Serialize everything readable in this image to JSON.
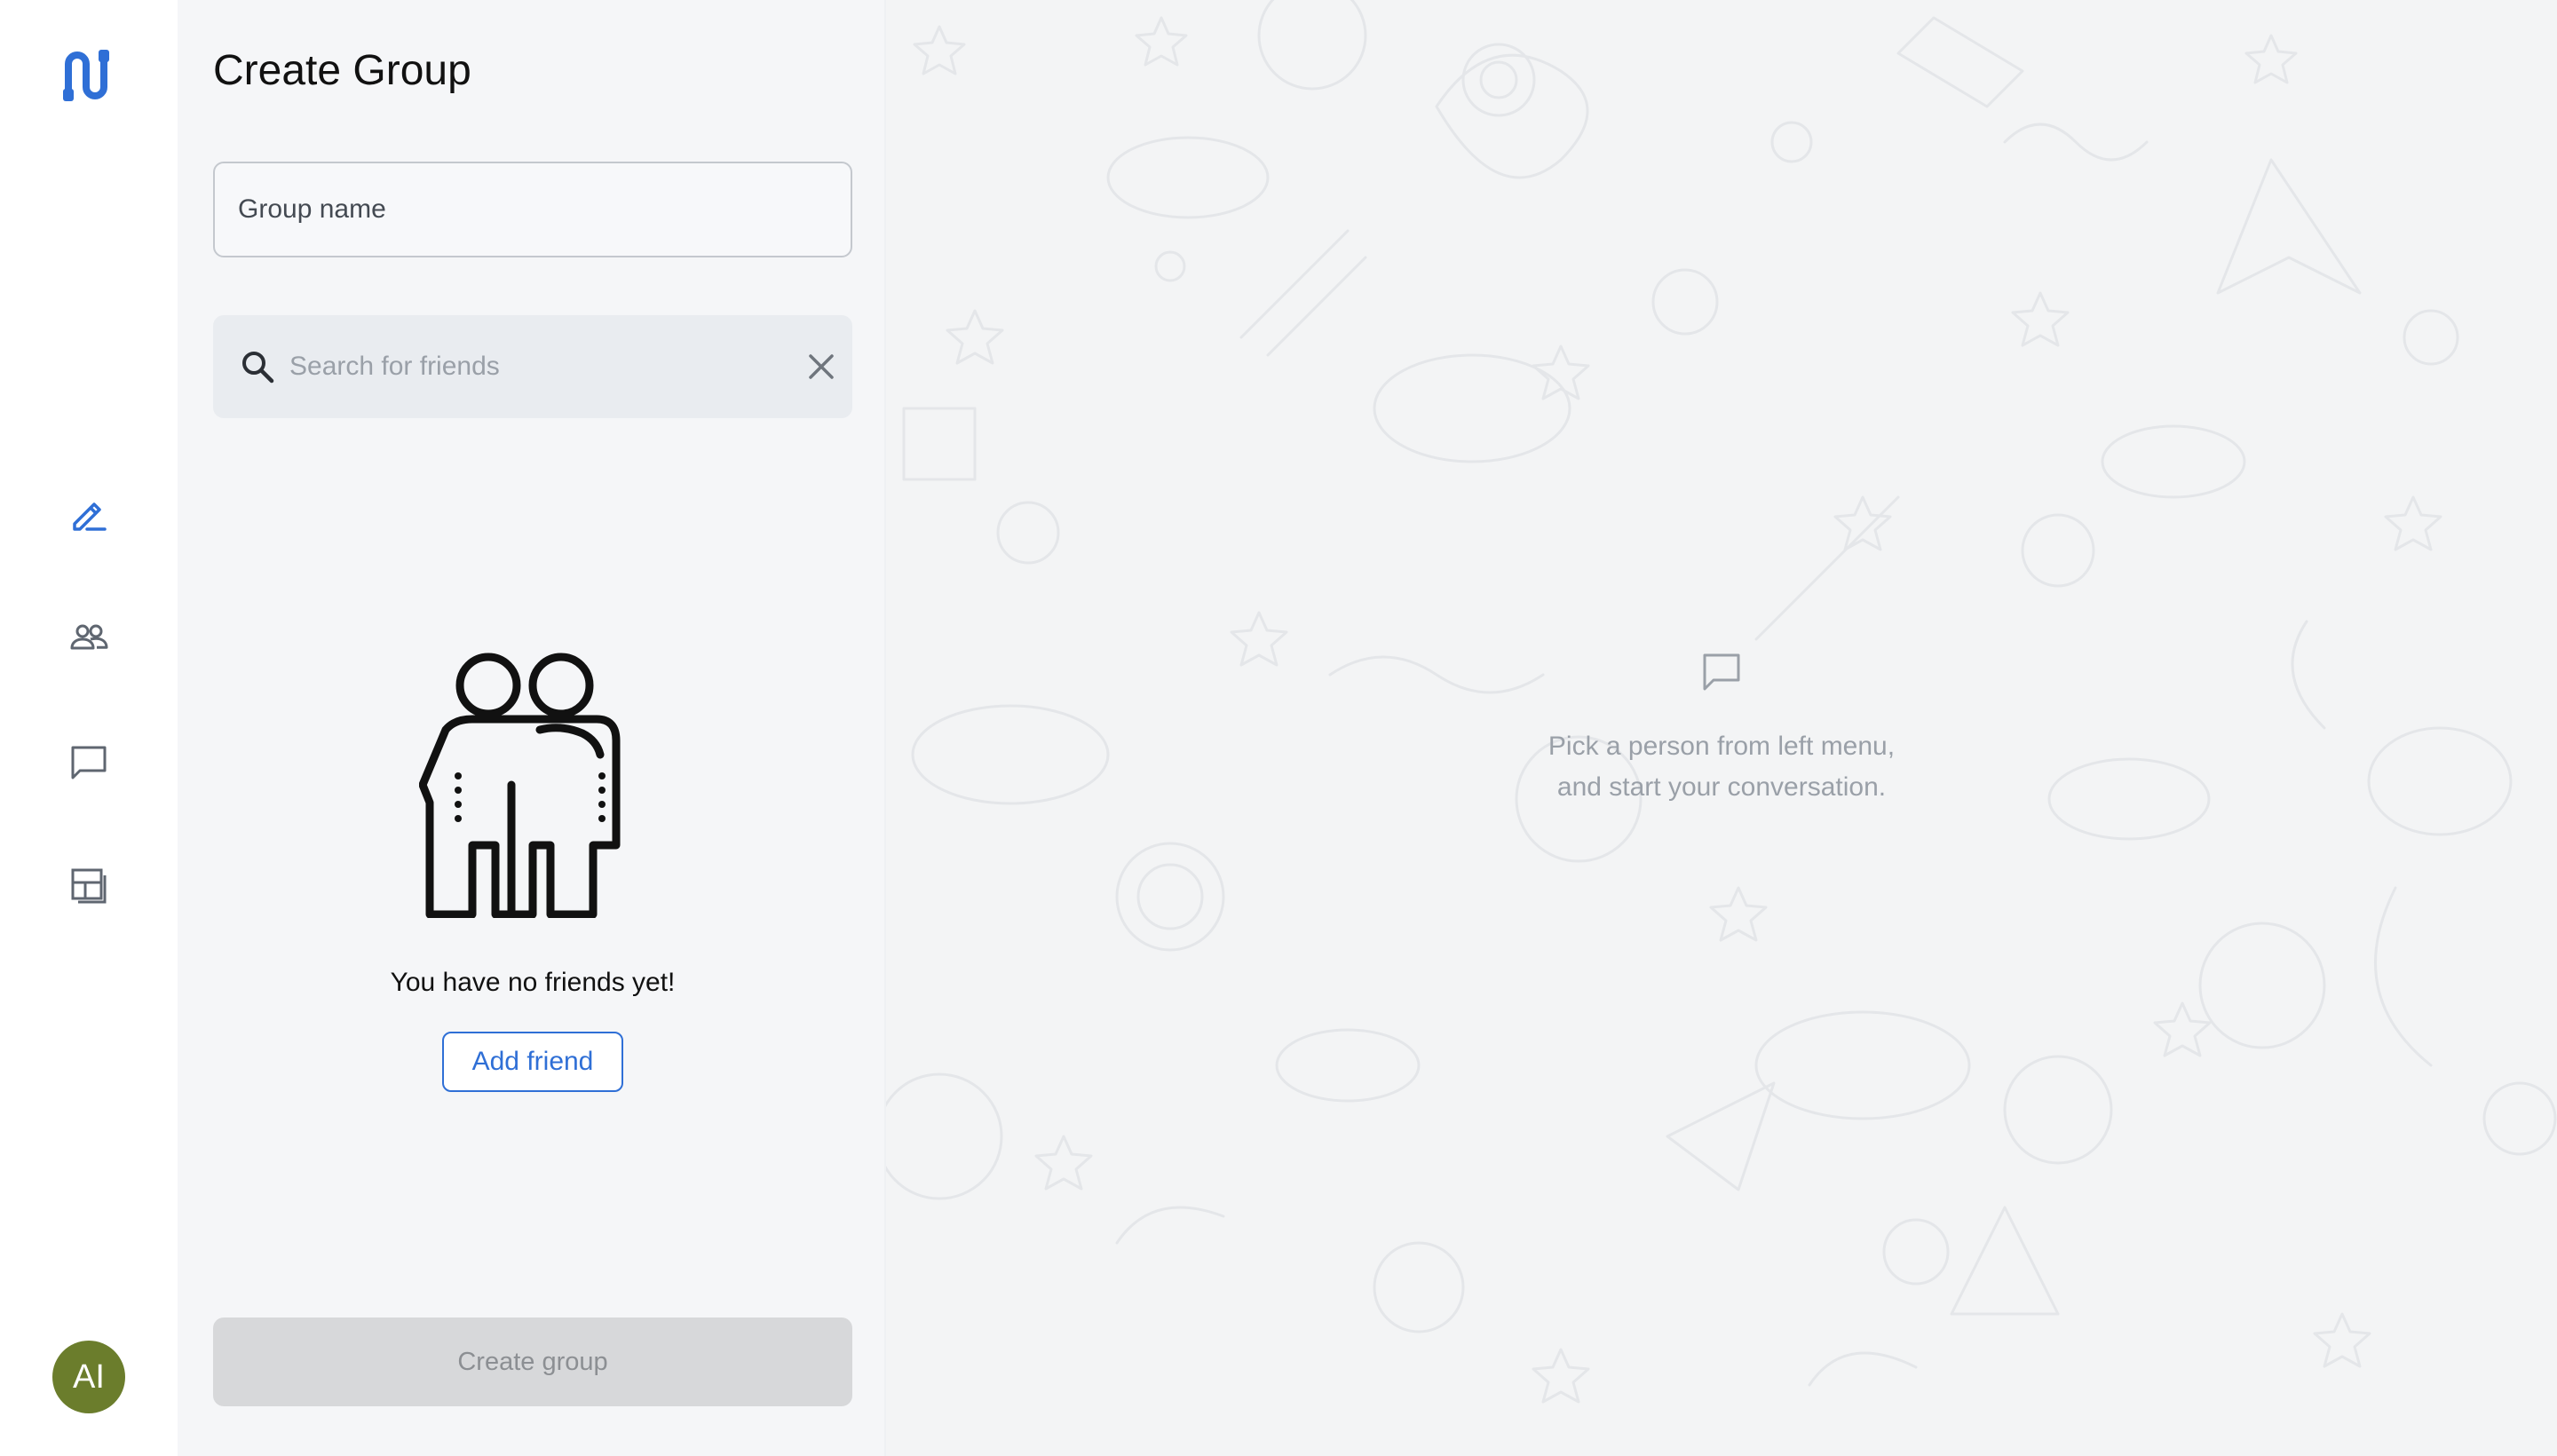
{
  "app": {
    "logo_icon": "connector-logo-icon",
    "accent_color": "#2f6fd6"
  },
  "rail": {
    "items": [
      {
        "name": "new-chat",
        "icon": "pencil-edit-icon",
        "active": true
      },
      {
        "name": "contacts",
        "icon": "people-icon",
        "active": false
      },
      {
        "name": "chats",
        "icon": "chat-bubble-icon",
        "active": false
      },
      {
        "name": "layout",
        "icon": "layout-icon",
        "active": false
      }
    ],
    "avatar": {
      "initials": "AI",
      "color": "#6b7d2c"
    }
  },
  "panel": {
    "title": "Create Group",
    "group_name": {
      "placeholder": "Group name",
      "value": ""
    },
    "search": {
      "placeholder": "Search for friends",
      "value": ""
    },
    "empty_state": {
      "illustration": "two-friends-hugging-icon",
      "text": "You have no friends yet!",
      "action_label": "Add friend"
    },
    "create_button": {
      "label": "Create group",
      "disabled": true
    }
  },
  "chat_area": {
    "placeholder_icon": "chat-bubble-icon",
    "line1": "Pick a person from left menu,",
    "line2": "and start your conversation."
  }
}
